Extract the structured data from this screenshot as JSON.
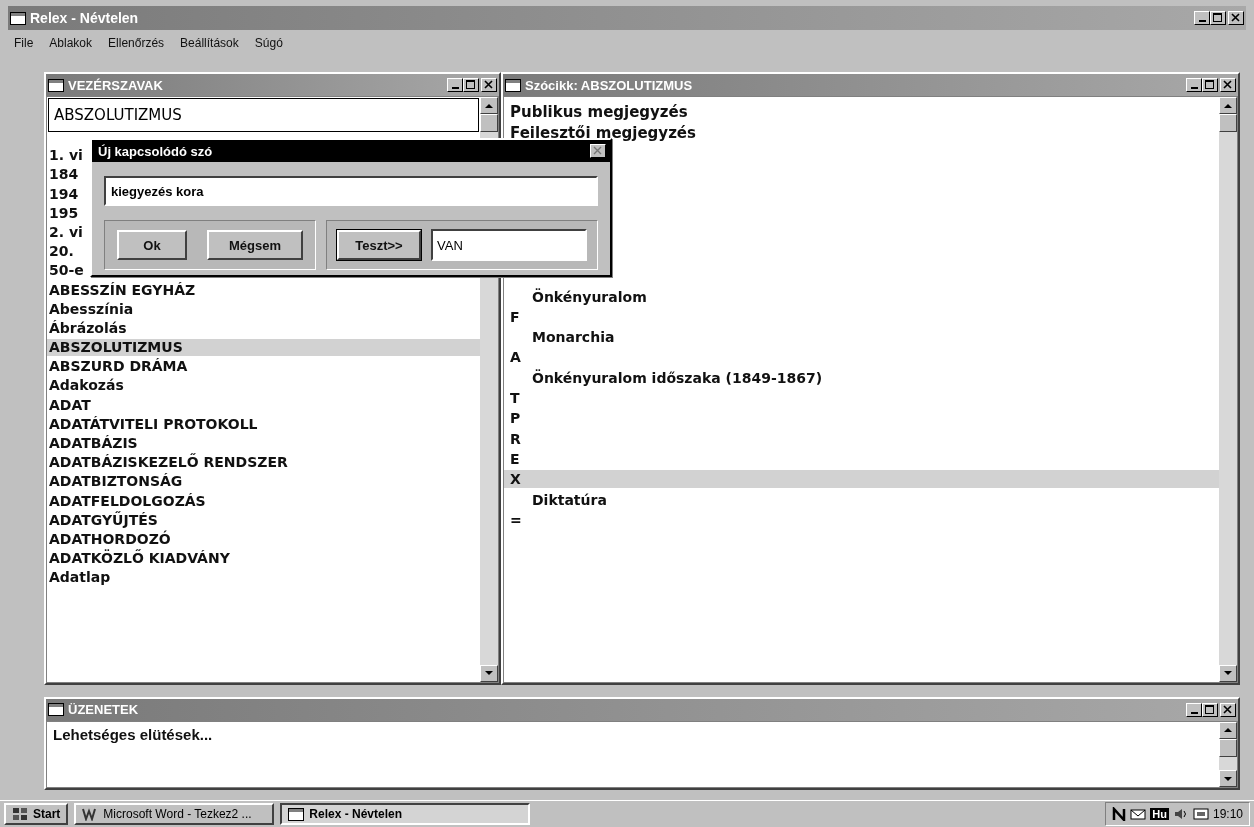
{
  "window": {
    "title": "Relex - Névtelen"
  },
  "menu": [
    "File",
    "Ablakok",
    "Ellenőrzés",
    "Beállítások",
    "Súgó"
  ],
  "keywords_panel": {
    "title": "VEZÉRSZAVAK",
    "search_value": "ABSZOLUTIZMUS",
    "items": [
      {
        "label": "1. vi",
        "selected": false
      },
      {
        "label": "184",
        "selected": false
      },
      {
        "label": "194",
        "selected": false
      },
      {
        "label": "195",
        "selected": false
      },
      {
        "label": "2. vi",
        "selected": false
      },
      {
        "label": "20.",
        "selected": false
      },
      {
        "label": "50-e",
        "selected": false
      },
      {
        "label": "ABESSZÍN EGYHÁZ",
        "selected": false
      },
      {
        "label": "Abesszínia",
        "selected": false
      },
      {
        "label": "Ábrázolás",
        "selected": false
      },
      {
        "label": "ABSZOLUTIZMUS",
        "selected": true
      },
      {
        "label": "ABSZURD DRÁMA",
        "selected": false
      },
      {
        "label": "Adakozás",
        "selected": false
      },
      {
        "label": "ADAT",
        "selected": false
      },
      {
        "label": "ADATÁTVITELI PROTOKOLL",
        "selected": false
      },
      {
        "label": "ADATBÁZIS",
        "selected": false
      },
      {
        "label": "ADATBÁZISKEZELŐ RENDSZER",
        "selected": false
      },
      {
        "label": "ADATBIZTONSÁG",
        "selected": false
      },
      {
        "label": "ADATFELDOLGOZÁS",
        "selected": false
      },
      {
        "label": "ADATGYŰJTÉS",
        "selected": false
      },
      {
        "label": "ADATHORDOZÓ",
        "selected": false
      },
      {
        "label": "ADATKÖZLŐ KIADVÁNY",
        "selected": false
      },
      {
        "label": "Adatlap",
        "selected": false
      }
    ]
  },
  "article_panel": {
    "title": "Szócikk: ABSZOLUTIZMUS",
    "lines": [
      {
        "kind": "note",
        "text": "Publikus megjegyzés",
        "selected": false
      },
      {
        "kind": "note",
        "text": "Fejlesztői megjegyzés",
        "selected": false
      },
      {
        "kind": "entry",
        "text": "Önkényuralom",
        "selected": false
      },
      {
        "kind": "letter",
        "text": "F",
        "selected": false
      },
      {
        "kind": "entry",
        "text": "Monarchia",
        "selected": false
      },
      {
        "kind": "letter",
        "text": "A",
        "selected": false
      },
      {
        "kind": "entry",
        "text": "Önkényuralom időszaka (1849-1867)",
        "selected": false
      },
      {
        "kind": "letter",
        "text": "T",
        "selected": false
      },
      {
        "kind": "letter",
        "text": "P",
        "selected": false
      },
      {
        "kind": "letter",
        "text": "R",
        "selected": false
      },
      {
        "kind": "letter",
        "text": "E",
        "selected": false
      },
      {
        "kind": "letter",
        "text": "X",
        "selected": true
      },
      {
        "kind": "entry",
        "text": "Diktatúra",
        "selected": false
      },
      {
        "kind": "letter",
        "text": "=",
        "selected": false
      }
    ]
  },
  "dialog": {
    "title": "Új kapcsolódó szó",
    "value": "kiegyezés kora",
    "buttons": [
      "Ok",
      "Mégsem"
    ],
    "test_button": "Teszt>>",
    "result": "VAN"
  },
  "messages_panel": {
    "title": "ÜZENETEK",
    "text": "Lehetséges elütések..."
  },
  "taskbar": {
    "start": "Start",
    "tasks": [
      {
        "label": "Microsoft Word - Tezkez2 ...",
        "selected": false
      },
      {
        "label": "Relex - Névtelen",
        "selected": true
      }
    ],
    "language": "Hu",
    "clock": "19:10"
  }
}
